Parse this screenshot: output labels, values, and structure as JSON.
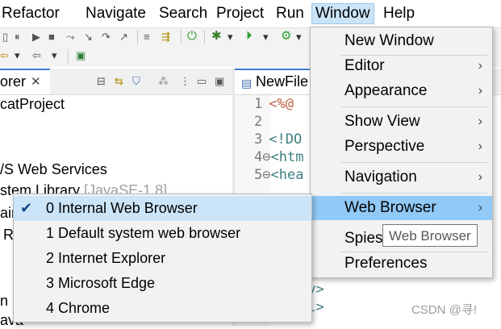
{
  "menubar": {
    "items": [
      "Refactor",
      "Navigate",
      "Search",
      "Project",
      "Run",
      "Window",
      "Help"
    ]
  },
  "explorer": {
    "tab_label": "orer",
    "items": [
      "catProject",
      "/S Web Services",
      "stem Library",
      "[JavaSE-1.8]",
      "ain",
      "R",
      "n",
      "ava"
    ]
  },
  "editor": {
    "tab_label": "NewFile",
    "lines": [
      {
        "num": "1",
        "code": "<%@"
      },
      {
        "num": "2",
        "code": ""
      },
      {
        "num": "3",
        "code": "<!DO"
      },
      {
        "num": "4⊖",
        "code": "<htm"
      },
      {
        "num": "5⊖",
        "code": "<hea"
      },
      {
        "num": "",
        "code": "dy>"
      },
      {
        "num": "",
        "code": "ml>"
      }
    ]
  },
  "window_menu": {
    "items": [
      {
        "label": "New Window"
      },
      {
        "label": "Editor",
        "submenu": true
      },
      {
        "label": "Appearance",
        "submenu": true
      },
      {
        "label": "Show View",
        "submenu": true
      },
      {
        "label": "Perspective",
        "submenu": true
      },
      {
        "label": "Navigation",
        "submenu": true
      },
      {
        "label": "Web Browser",
        "submenu": true
      },
      {
        "label": "Spies"
      },
      {
        "label": "Preferences"
      }
    ]
  },
  "browser_submenu": {
    "items": [
      {
        "label": "0 Internal Web Browser",
        "checked": true
      },
      {
        "label": "1 Default system web browser"
      },
      {
        "label": "2 Internet Explorer"
      },
      {
        "label": "3 Microsoft Edge"
      },
      {
        "label": "4 Chrome"
      }
    ]
  },
  "tooltip": "Web Browser",
  "watermark": "CSDN @寻!"
}
